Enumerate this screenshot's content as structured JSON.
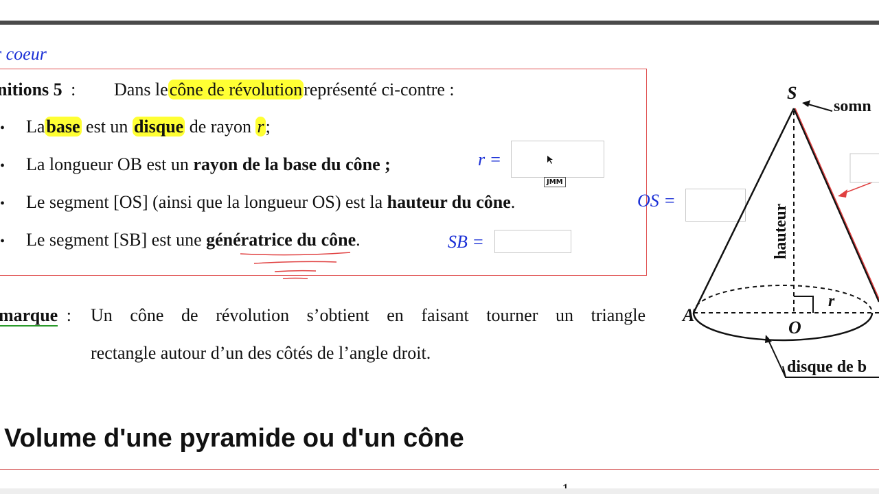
{
  "header": {
    "section_fragment": "r coeur"
  },
  "definition": {
    "label": "nitions 5",
    "sep": ":",
    "intro_pre": "Dans le",
    "intro_hl": "cône de révolution",
    "intro_post": "représenté ci-contre :",
    "item1": {
      "a": "La",
      "b": "base",
      "c": "est un",
      "d": "disque",
      "e": "de rayon",
      "f": "r",
      "g": ";"
    },
    "item2": {
      "a": "La longueur OB est un",
      "b": "rayon de la base du cône ;"
    },
    "item3": {
      "a": "Le segment [OS] (ainsi que la longueur OS) est la",
      "b": "hauteur du cône",
      "c": "."
    },
    "item4": {
      "a": "Le segment [SB] est une",
      "b": "génératrice du cône",
      "c": "."
    },
    "fields": {
      "r": "r =",
      "os": "OS =",
      "sb": "SB ="
    },
    "cursor_badge": "JMM"
  },
  "remark": {
    "label": "marque",
    "sep": ":",
    "line1": "Un cône de révolution s’obtient en faisant tourner un triangle",
    "line2": "rectangle autour d’un des côtés de l’angle droit."
  },
  "figure": {
    "S": "S",
    "A": "A",
    "O": "O",
    "r": "r",
    "sommet": "somn",
    "hauteur": "hauteur",
    "disque": "disque de b"
  },
  "section2": {
    "title": "Volume d'une pyramide ou d'un cône",
    "fragment": "1"
  },
  "colors": {
    "highlight": "#ffff33",
    "annot_blue": "#1a2fd6",
    "box_red": "#e05050"
  }
}
